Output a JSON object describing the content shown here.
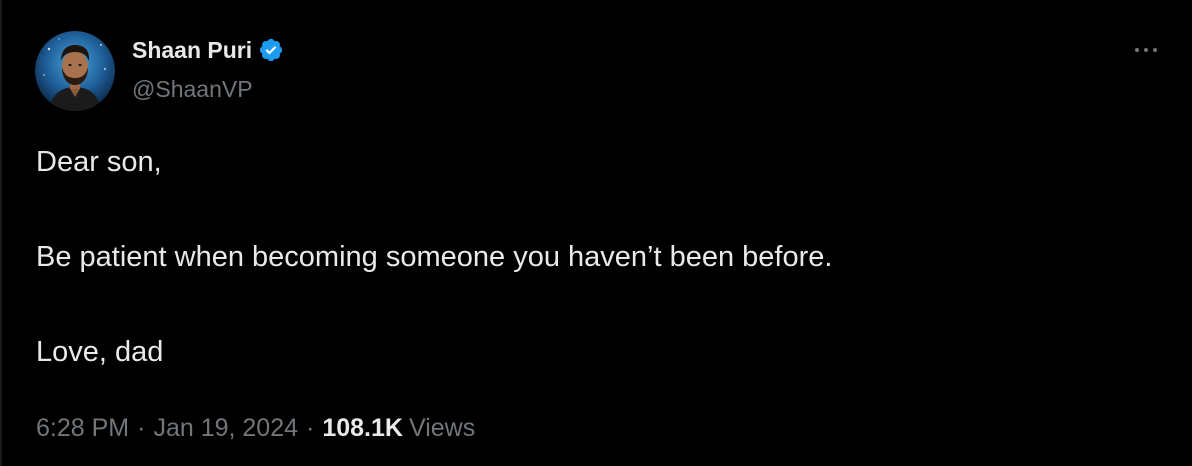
{
  "author": {
    "display_name": "Shaan Puri",
    "handle": "@ShaanVP",
    "avatar_icon": "profile-photo",
    "verified_icon": "verified-badge-icon",
    "verified_color": "#1d9bf0"
  },
  "menu": {
    "icon": "more-horizontal-icon"
  },
  "tweet": {
    "lines": [
      "Dear son,",
      "Be patient when becoming someone you haven’t been before.",
      "Love, dad"
    ]
  },
  "meta": {
    "time": "6:28 PM",
    "separator": "·",
    "date": "Jan 19, 2024",
    "views_count": "108.1K",
    "views_label": "Views"
  },
  "colors": {
    "background": "#000000",
    "primary_text": "#e7e9ea",
    "secondary_text": "#71767b"
  }
}
